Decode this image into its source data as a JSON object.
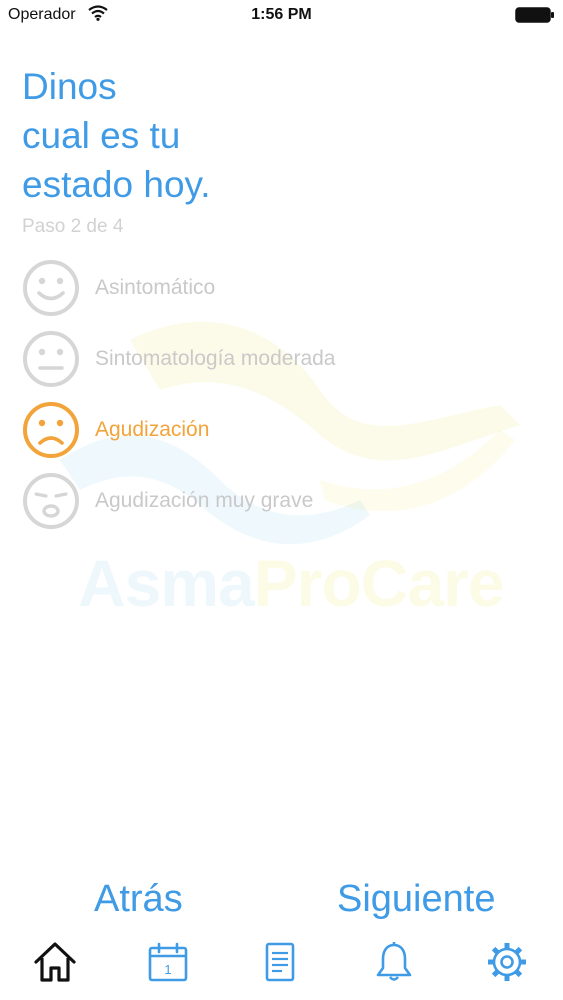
{
  "status_bar": {
    "carrier": "Operador",
    "time": "1:56 PM"
  },
  "screen": {
    "title_lines": [
      "Dinos",
      "cual es tu",
      "estado hoy."
    ],
    "step_label": "Paso 2 de 4",
    "watermark": {
      "part1": "Asma",
      "part2": "ProCare"
    }
  },
  "options": [
    {
      "label": "Asintomático",
      "face": "smile-face-icon",
      "selected": false
    },
    {
      "label": "Sintomatología moderada",
      "face": "neutral-face-icon",
      "selected": false
    },
    {
      "label": "Agudización",
      "face": "sad-face-icon",
      "selected": true
    },
    {
      "label": "Agudización muy grave",
      "face": "very-sad-face-icon",
      "selected": false
    }
  ],
  "navigation": {
    "back_label": "Atrás",
    "next_label": "Siguiente"
  },
  "tab_bar": {
    "tabs": [
      {
        "icon": "home-icon",
        "active": true
      },
      {
        "icon": "calendar-icon",
        "active": false,
        "badge": "1"
      },
      {
        "icon": "document-icon",
        "active": false
      },
      {
        "icon": "bell-icon",
        "active": false
      },
      {
        "icon": "gear-icon",
        "active": false
      }
    ]
  },
  "colors": {
    "accent_blue": "#3f9be6",
    "selected_orange": "#f2a33a",
    "inactive_gray": "#c9c9c9"
  }
}
